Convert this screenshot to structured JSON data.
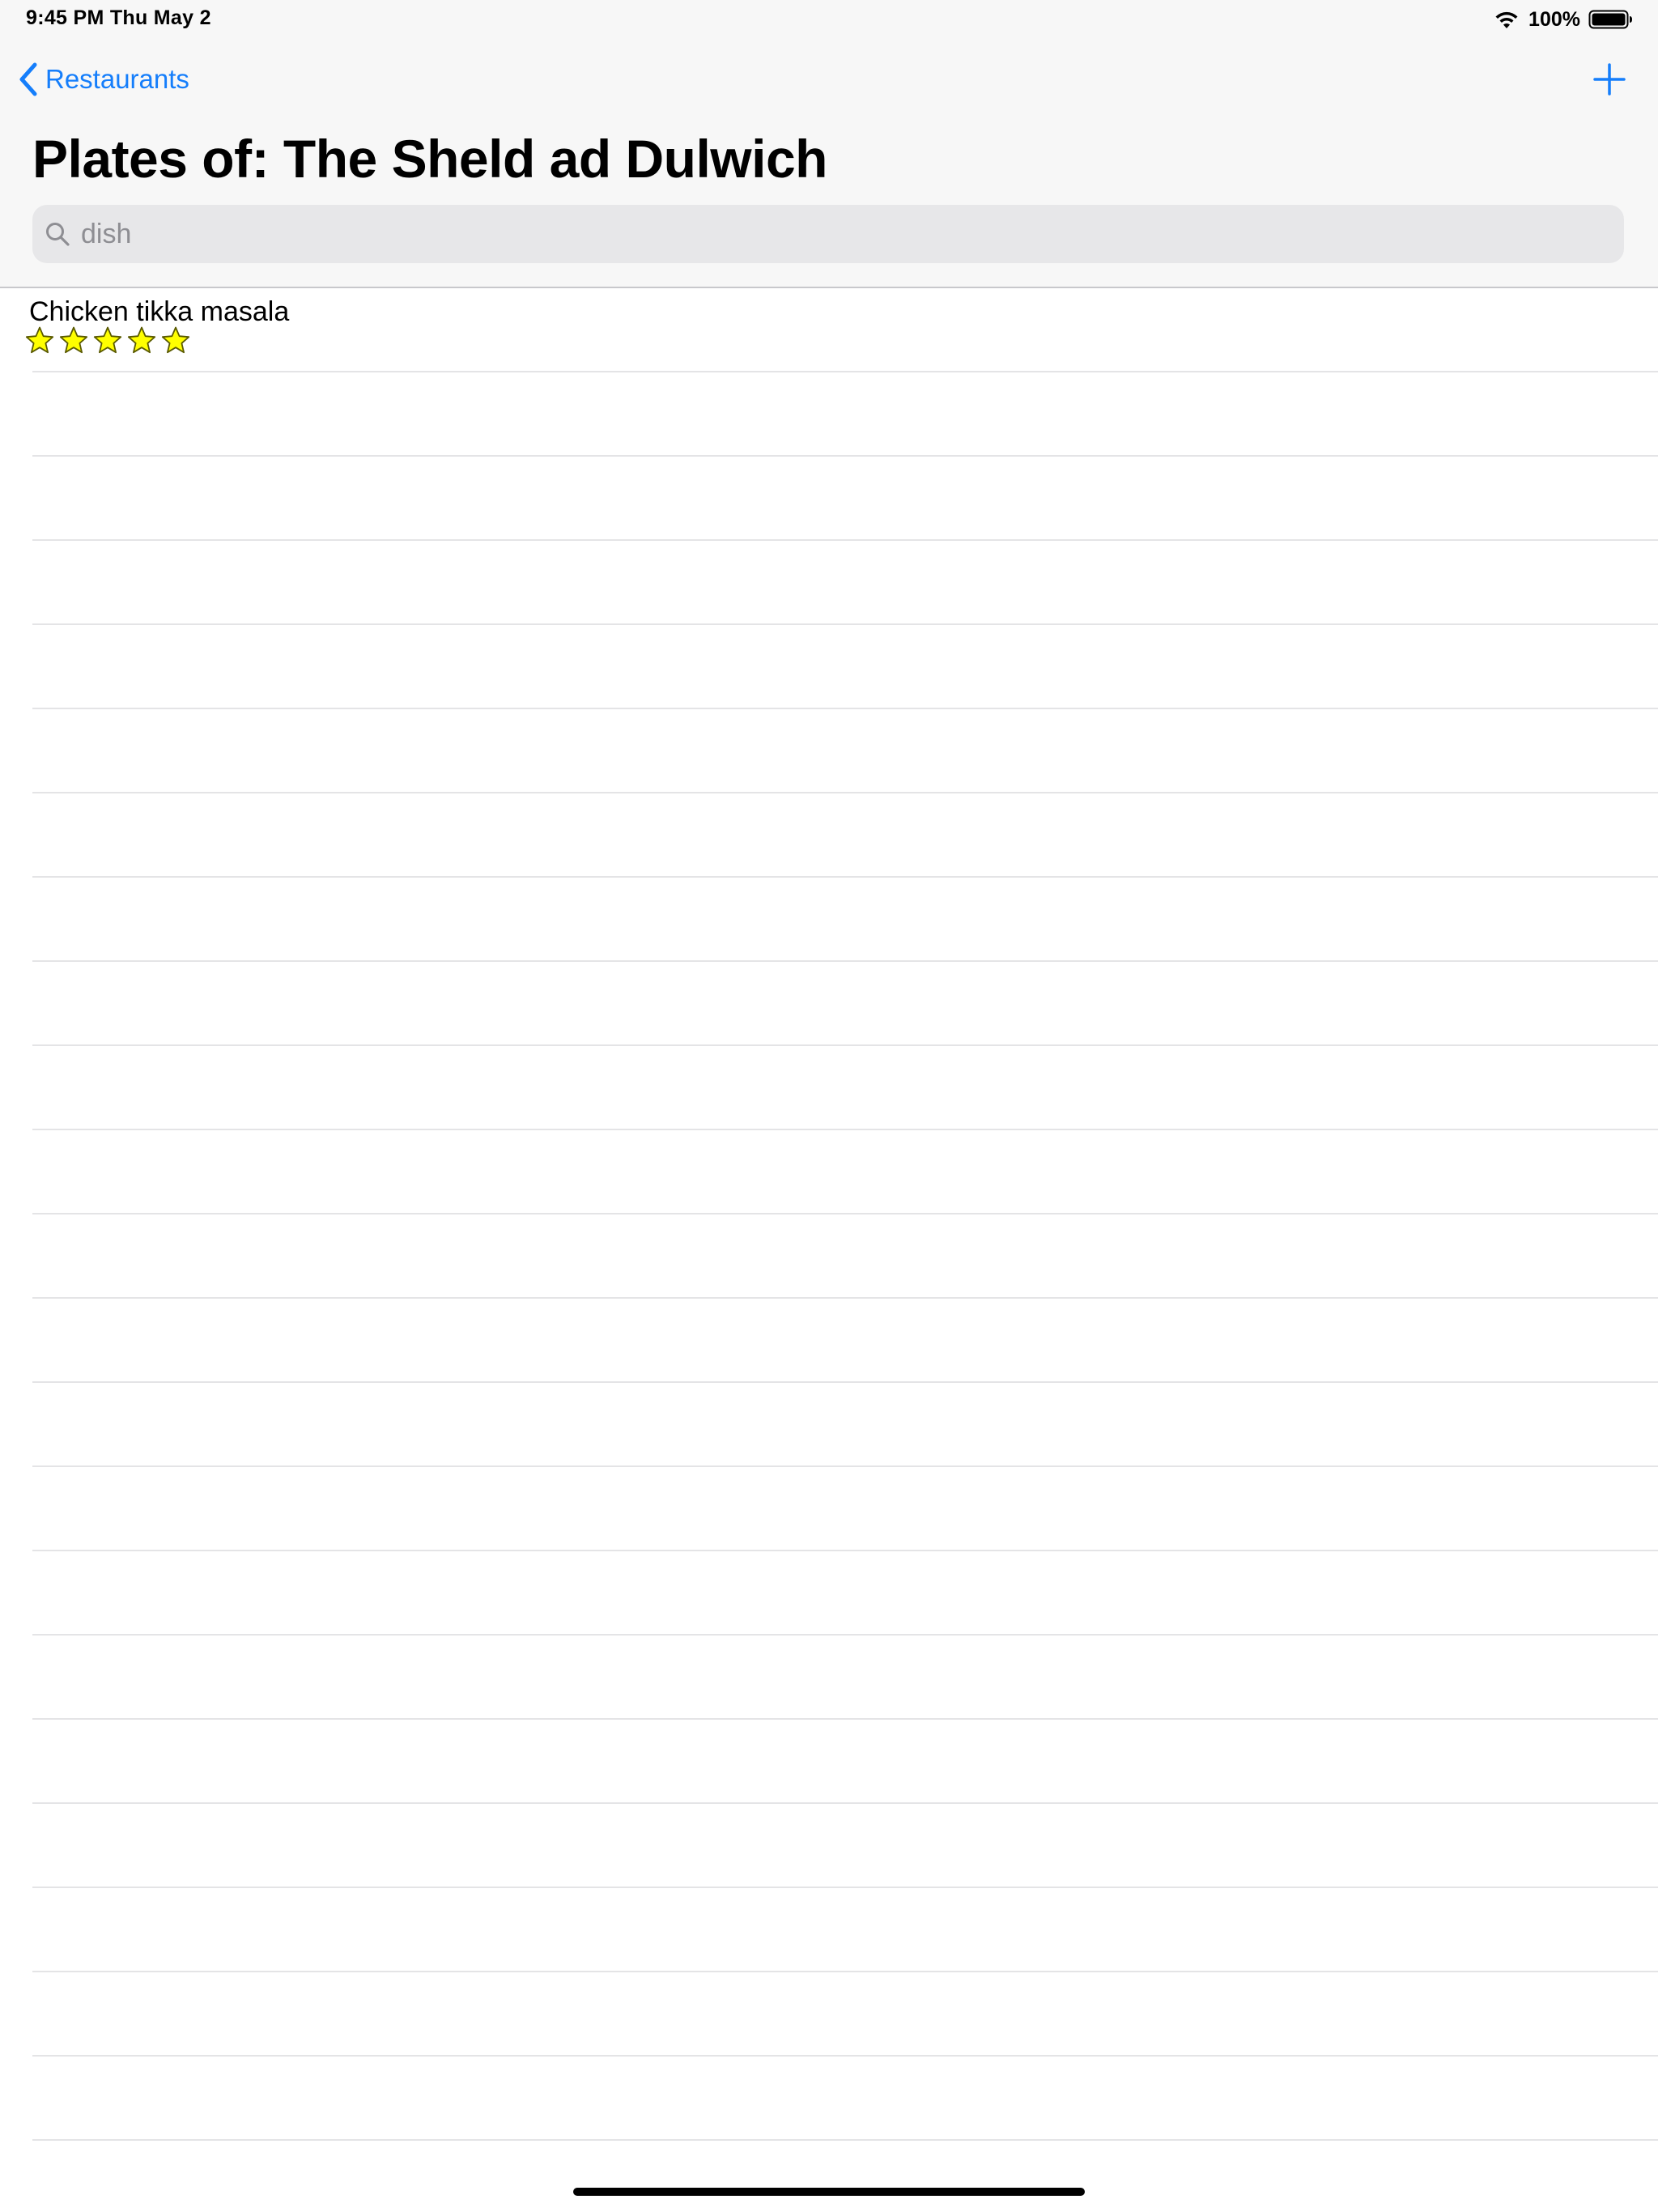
{
  "status_bar": {
    "time": "9:45 PM   Thu May 2",
    "battery_percent": "100%"
  },
  "nav": {
    "back_label": "Restaurants",
    "add_icon": "plus-icon"
  },
  "title": "Plates of: The Sheld ad Dulwich",
  "search": {
    "placeholder": "dish",
    "value": ""
  },
  "plates": [
    {
      "name": "Chicken tikka masala",
      "rating": 5,
      "max_rating": 5
    }
  ],
  "empty_rows": 21,
  "colors": {
    "accent": "#157efb",
    "star_fill": "#ffff00",
    "star_stroke": "#5a5a00",
    "header_bg": "#f7f7f7",
    "search_bg": "#e7e7e9",
    "separator": "#e4e4e6"
  }
}
